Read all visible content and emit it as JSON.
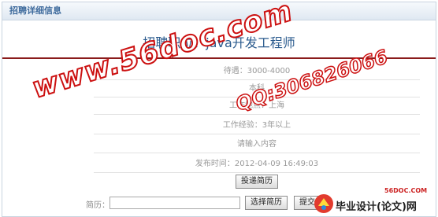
{
  "panel": {
    "header_title": "招聘详细信息"
  },
  "job": {
    "title": "招聘职位：java开发工程师",
    "salary": "待遇：3000-4000",
    "education": "本科",
    "location": "工作地点：上海",
    "experience": "工作经验：3年以上",
    "content": "请输入内容",
    "publish_time": "发布时间：2012-04-09 16:49:03"
  },
  "buttons": {
    "deliver_resume": "投递简历",
    "choose_resume": "选择简历",
    "submit": "提交"
  },
  "resume": {
    "label": "简历：",
    "value": ""
  },
  "watermarks": {
    "site": "www.56doc.com",
    "qq": "QQ:306826066"
  },
  "logo": {
    "small": "56DOC.COM",
    "text": "毕业设计(论文)网"
  },
  "colors": {
    "watermark": "#cc1111",
    "title_rule": "#8a1b1b",
    "header_text": "#3d6a9c",
    "job_title": "#2b5b8e"
  }
}
